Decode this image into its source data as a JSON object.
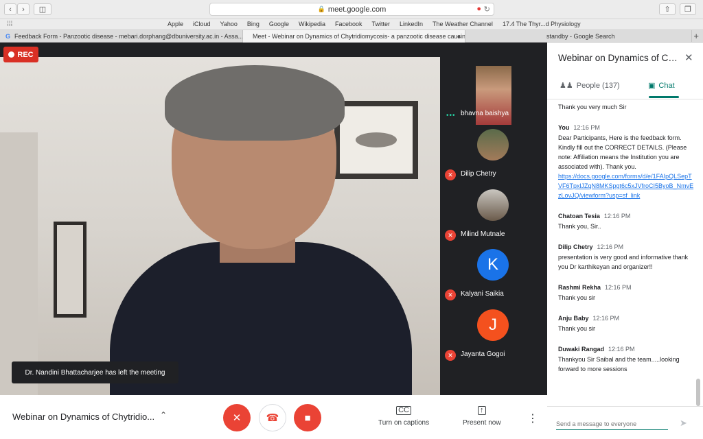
{
  "browser": {
    "url": "meet.google.com",
    "bookmarks": [
      "Apple",
      "iCloud",
      "Yahoo",
      "Bing",
      "Google",
      "Wikipedia",
      "Facebook",
      "Twitter",
      "LinkedIn",
      "The Weather Channel",
      "17.4 The Thyr...d Physiology"
    ],
    "tabs": [
      {
        "favicon": "G",
        "title": "Feedback Form - Panzootic disease - mebari.dorphang@dbuniversity.ac.in - Assa..."
      },
      {
        "favicon": "",
        "title": "Meet - Webinar on Dynamics of Chytridiomycosis- a panzootic disease causin..."
      },
      {
        "favicon": "",
        "title": "standby - Google Search"
      }
    ],
    "new_tab": "+"
  },
  "meet": {
    "rec_label": "REC",
    "toast": "Dr. Nandini Bhattacharjee has left the meeting",
    "participants": [
      {
        "name": "bhavna baishya",
        "type": "photo",
        "speaking": true
      },
      {
        "name": "Dilip Chetry",
        "type": "photo",
        "muted": true
      },
      {
        "name": "Milind Mutnale",
        "type": "photo",
        "muted": true
      },
      {
        "name": "Kalyani Saikia",
        "type": "avatar",
        "initial": "K",
        "color": "#1a73e8",
        "muted": true
      },
      {
        "name": "Jayanta Gogoi",
        "type": "avatar",
        "initial": "J",
        "color": "#f4511e",
        "muted": true
      }
    ]
  },
  "bottom_bar": {
    "meeting_title": "Webinar on Dynamics of Chytridio...",
    "captions_label": "Turn on captions",
    "present_label": "Present now"
  },
  "panel": {
    "title": "Webinar on Dynamics of Chytridiomycosis",
    "people_label": "People (137)",
    "chat_label": "Chat",
    "messages": [
      {
        "sender": "",
        "time": "",
        "text": "Thank you very much Sir"
      },
      {
        "sender": "You",
        "time": "12:16 PM",
        "text": "Dear Participants, Here is the feedback form. Kindly fill out the CORRECT DETAILS. (Please note: Affiliation means the Institution you are associated with). Thank you.",
        "link": "https://docs.google.com/forms/d/e/1FAIpQLSepTVF6TpxlJZqN8MKSpgt6c5xJVfroCI5ByoB_NmvEzLovJQ/viewform?usp=sf_link"
      },
      {
        "sender": "Chatoan Tesia",
        "time": "12:16 PM",
        "text": "Thank you, Sir.."
      },
      {
        "sender": "Dilip Chetry",
        "time": "12:16 PM",
        "text": "presentation is very good and informative thank you Dr karthikeyan and organizer!!"
      },
      {
        "sender": "Rashmi Rekha",
        "time": "12:16 PM",
        "text": "Thank you sir"
      },
      {
        "sender": "Anju Baby",
        "time": "12:16 PM",
        "text": "Thank you sir"
      },
      {
        "sender": "Duwaki Rangad",
        "time": "12:16 PM",
        "text": "Thankyou Sir Saibal and the team.....looking forward to more sessions"
      }
    ],
    "input_placeholder": "Send a message to everyone"
  },
  "colors": {
    "rec_red": "#d93025",
    "mute_red": "#ea4335",
    "chat_teal": "#00796b",
    "link_blue": "#1a73e8"
  }
}
